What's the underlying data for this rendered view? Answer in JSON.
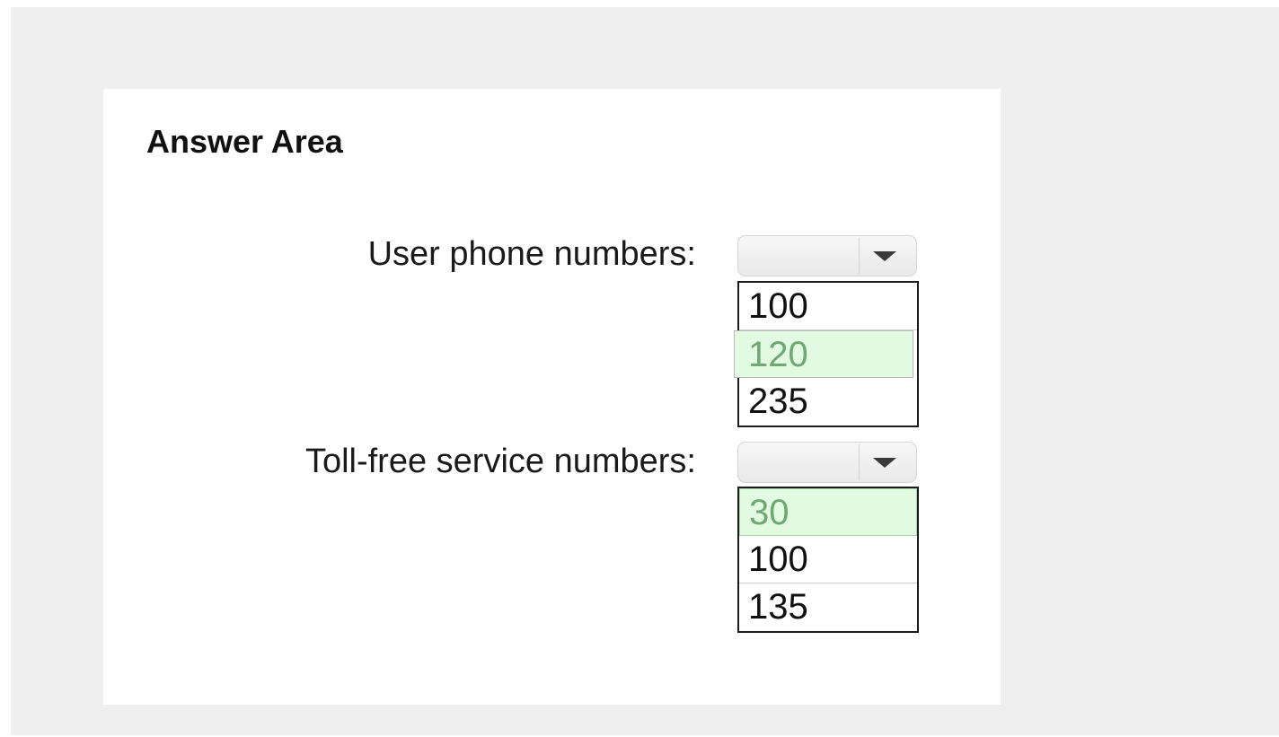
{
  "answer_area": {
    "title": "Answer Area",
    "fields": [
      {
        "label": "User phone numbers:",
        "selected_value": "",
        "options": [
          {
            "text": "100",
            "selected": false
          },
          {
            "text": "120",
            "selected": true
          },
          {
            "text": "235",
            "selected": false
          }
        ]
      },
      {
        "label": "Toll-free service numbers:",
        "selected_value": "",
        "options": [
          {
            "text": "30",
            "selected": true
          },
          {
            "text": "100",
            "selected": false
          },
          {
            "text": "135",
            "selected": false
          }
        ]
      }
    ]
  },
  "colors": {
    "page_background": "#efefef",
    "panel_background": "#ffffff",
    "selected_option_background": "#e2fae2",
    "selected_option_text": "#6fa872"
  },
  "icons": {
    "dropdown": "chevron-down-icon"
  }
}
